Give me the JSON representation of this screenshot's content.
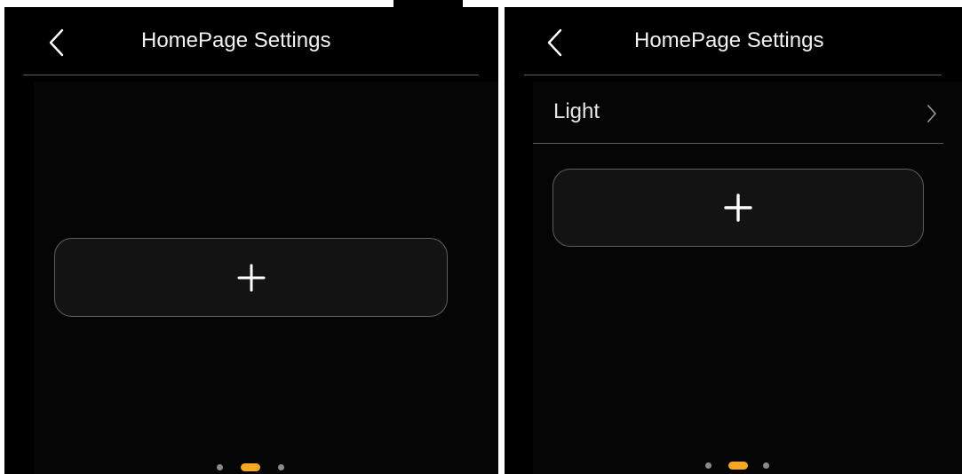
{
  "colors": {
    "background": "#000000",
    "accent": "#f5a623",
    "divider": "#5a5a5a",
    "card_border": "#5e5e5e",
    "inactive_dot": "#8a8a8a"
  },
  "screens": [
    {
      "header": {
        "back_icon": "chevron-left-icon",
        "title": "HomePage Settings"
      },
      "items": [],
      "add_card": {
        "icon": "plus-icon"
      },
      "pager": {
        "pages": 3,
        "active_page": 2
      }
    },
    {
      "header": {
        "back_icon": "chevron-left-icon",
        "title": "HomePage Settings"
      },
      "items": [
        {
          "label": "Light",
          "icon": "chevron-right-icon"
        }
      ],
      "add_card": {
        "icon": "plus-icon"
      },
      "pager": {
        "pages": 3,
        "active_page": 2
      }
    }
  ]
}
